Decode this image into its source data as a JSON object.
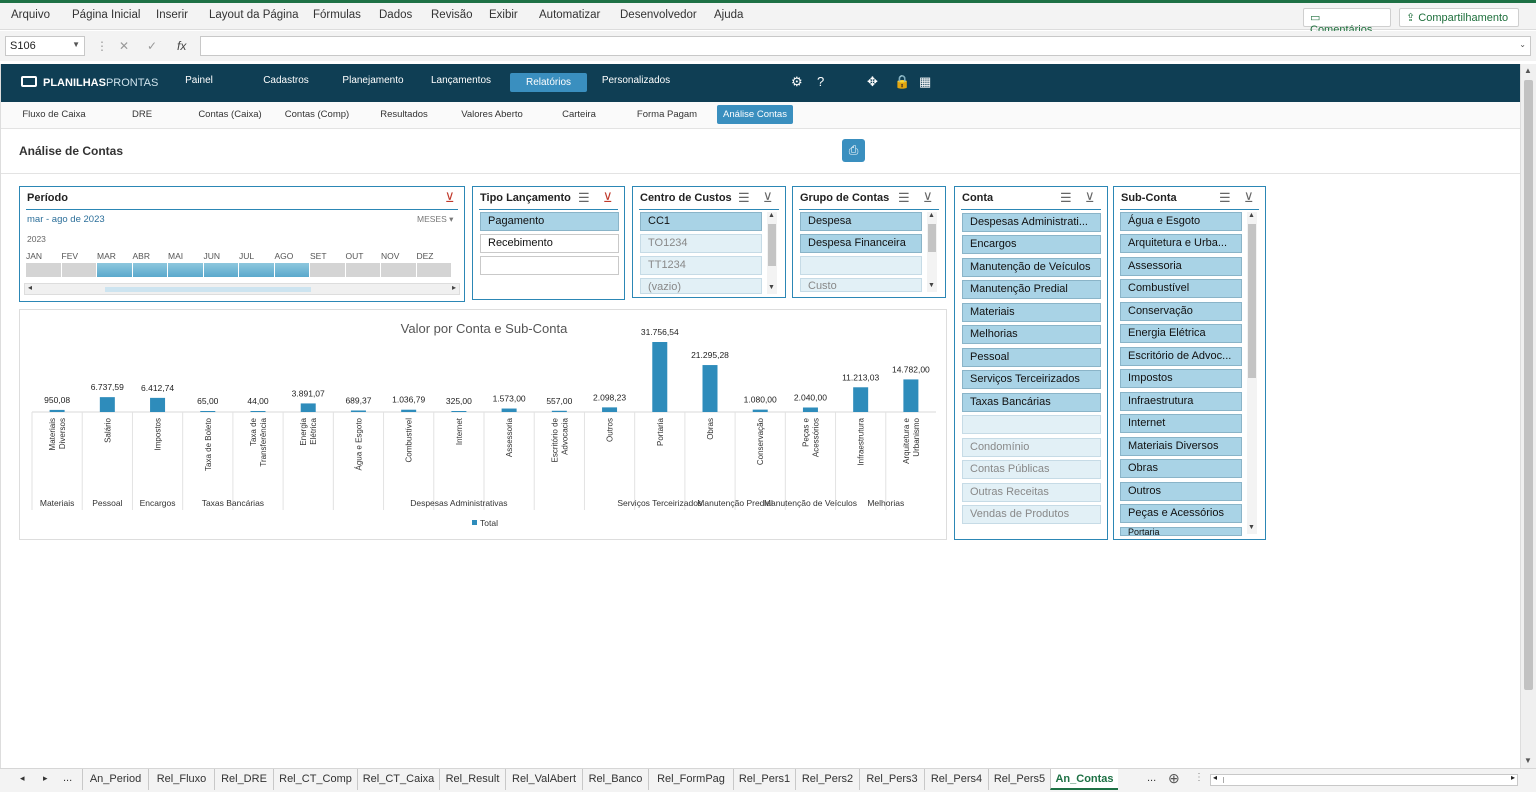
{
  "menu": {
    "items": [
      "Arquivo",
      "Página Inicial",
      "Inserir",
      "Layout da Página",
      "Fórmulas",
      "Dados",
      "Revisão",
      "Exibir",
      "Automatizar",
      "Desenvolvedor",
      "Ajuda"
    ],
    "comments": "Comentários",
    "share": "Compartilhamento"
  },
  "formula_bar": {
    "cell_ref": "S106",
    "fx": "fx",
    "value": ""
  },
  "nav": {
    "logo_bold": "PLANILHAS",
    "logo_light": "PRONTAS",
    "items": [
      "Painel",
      "Cadastros",
      "Planejamento",
      "Lançamentos",
      "Relatórios",
      "Personalizados"
    ],
    "active": "Relatórios"
  },
  "subnav": {
    "items": [
      "Fluxo de Caixa",
      "DRE",
      "Contas (Caixa)",
      "Contas (Comp)",
      "Resultados",
      "Valores Aberto",
      "Carteira",
      "Forma Pagam",
      "Análise Contas"
    ],
    "active": "Análise Contas"
  },
  "page_title": "Análise de Contas",
  "periodo": {
    "title": "Período",
    "range": "mar - ago de 2023",
    "unit": "MESES",
    "year": "2023",
    "months": [
      "JAN",
      "FEV",
      "MAR",
      "ABR",
      "MAI",
      "JUN",
      "JUL",
      "AGO",
      "SET",
      "OUT",
      "NOV",
      "DEZ"
    ],
    "selected_from_index": 2,
    "selected_to_index": 7
  },
  "tipo_lancamento": {
    "title": "Tipo Lançamento",
    "items": [
      "Pagamento",
      "Recebimento"
    ]
  },
  "centro_custos": {
    "title": "Centro de Custos",
    "items": [
      "CC1",
      "TO1234",
      "TT1234",
      "(vazio)"
    ]
  },
  "grupo_contas": {
    "title": "Grupo de Contas",
    "items": [
      "Despesa",
      "Despesa Financeira",
      "",
      "Custo"
    ]
  },
  "conta": {
    "title": "Conta",
    "items": [
      "Despesas Administrati...",
      "Encargos",
      "Manutenção de Veículos",
      "Manutenção Predial",
      "Materiais",
      "Melhorias",
      "Pessoal",
      "Serviços Terceirizados",
      "Taxas Bancárias",
      "",
      "Condomínio",
      "Contas Públicas",
      "Outras Receitas",
      "Vendas de Produtos"
    ]
  },
  "sub_conta": {
    "title": "Sub-Conta",
    "items": [
      "Água e Esgoto",
      "Arquitetura e Urba...",
      "Assessoria",
      "Combustível",
      "Conservação",
      "Energia Elétrica",
      "Escritório de Advoc...",
      "Impostos",
      "Infraestrutura",
      "Internet",
      "Materiais Diversos",
      "Obras",
      "Outros",
      "Peças e Acessórios",
      "Portaria"
    ]
  },
  "chart_data": {
    "type": "bar",
    "title": "Valor por Conta e Sub-Conta",
    "legend": [
      "Total"
    ],
    "legend_position": "bottom",
    "color": "#2e8cbb",
    "categories": [
      {
        "sub": "Materiais Diversos",
        "group": "Materiais",
        "value": 950.08,
        "label": "950,08"
      },
      {
        "sub": "Salário",
        "group": "Pessoal",
        "value": 6737.59,
        "label": "6.737,59"
      },
      {
        "sub": "Impostos",
        "group": "Encargos",
        "value": 6412.74,
        "label": "6.412,74"
      },
      {
        "sub": "Taxa de Boleto",
        "group": "Taxas Bancárias",
        "value": 65.0,
        "label": "65,00"
      },
      {
        "sub": "Taxa de Transferência",
        "group": "Taxas Bancárias",
        "value": 44.0,
        "label": "44,00"
      },
      {
        "sub": "Energia Elétrica",
        "group": "Despesas Administrativas",
        "value": 3891.07,
        "label": "3.891,07"
      },
      {
        "sub": "Água e Esgoto",
        "group": "Despesas Administrativas",
        "value": 689.37,
        "label": "689,37"
      },
      {
        "sub": "Combustível",
        "group": "Despesas Administrativas",
        "value": 1036.79,
        "label": "1.036,79"
      },
      {
        "sub": "Internet",
        "group": "Despesas Administrativas",
        "value": 325.0,
        "label": "325,00"
      },
      {
        "sub": "Assessoria",
        "group": "Despesas Administrativas",
        "value": 1573.0,
        "label": "1.573,00"
      },
      {
        "sub": "Escritório de Advocacia",
        "group": "Despesas Administrativas",
        "value": 557.0,
        "label": "557,00"
      },
      {
        "sub": "Outros",
        "group": "Despesas Administrativas",
        "value": 2098.23,
        "label": "2.098,23"
      },
      {
        "sub": "Portaria",
        "group": "Serviços Terceirizados",
        "value": 31756.54,
        "label": "31.756,54"
      },
      {
        "sub": "Obras",
        "group": "Manutenção Predial",
        "value": 21295.28,
        "label": "21.295,28"
      },
      {
        "sub": "Conservação",
        "group": "Manutenção Predial",
        "value": 1080.0,
        "label": "1.080,00"
      },
      {
        "sub": "Peças e Acessórios",
        "group": "Manutenção de Veículos",
        "value": 2040.0,
        "label": "2.040,00"
      },
      {
        "sub": "Infraestrutura",
        "group": "Melhorias",
        "value": 11213.03,
        "label": "11.213,03"
      },
      {
        "sub": "Arquitetura e Urbanismo",
        "group": "Melhorias",
        "value": 14782.0,
        "label": "14.782,00"
      }
    ],
    "groups": [
      "Materiais",
      "Pessoal",
      "Encargos",
      "Taxas Bancárias",
      "Despesas Administrativas",
      "Serviços Terceirizados",
      "Manutenção Predial",
      "Manutenção de Veículos",
      "Melhorias"
    ],
    "ylim": [
      0,
      35000
    ]
  },
  "sheet_tabs": {
    "items": [
      "An_Period",
      "Rel_Fluxo",
      "Rel_DRE",
      "Rel_CT_Comp",
      "Rel_CT_Caixa",
      "Rel_Result",
      "Rel_ValAbert",
      "Rel_Banco",
      "Rel_FormPag",
      "Rel_Pers1",
      "Rel_Pers2",
      "Rel_Pers3",
      "Rel_Pers4",
      "Rel_Pers5",
      "An_Contas"
    ],
    "active": "An_Contas",
    "more": "..."
  }
}
